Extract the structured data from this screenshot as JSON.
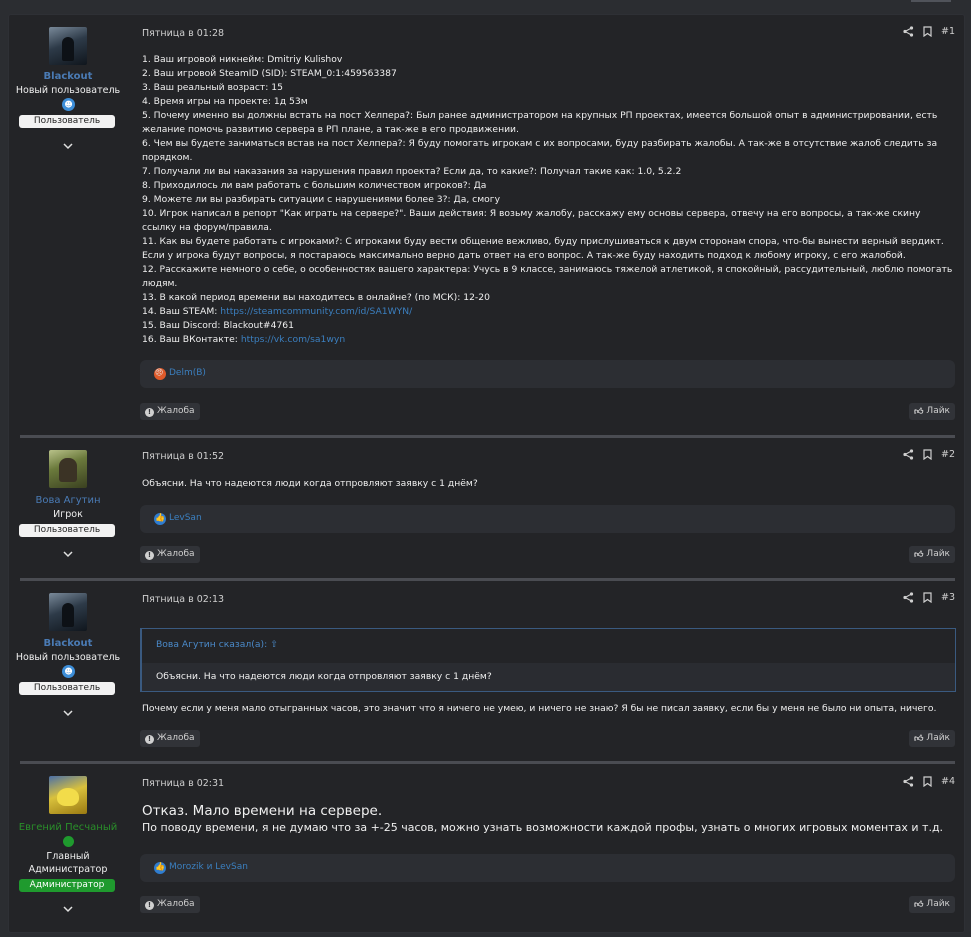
{
  "posts": [
    {
      "user": {
        "name": "Blackout",
        "title": "Новый пользователь",
        "badge": "Пользователь"
      },
      "date": "Пятница в 01:28",
      "number": "#1",
      "lines": [
        "1. Ваш игровой никнейм: Dmitriy Kulishov",
        "2. Ваш игровой SteamID (SID): STEAM_0:1:459563387",
        "3. Ваш реальный возраст: 15",
        "4. Время игры на проекте: 1д 53м",
        "5. Почему именно вы должны встать на пост Хелпера?: Был ранее администратором на крупных РП проектах, имеется большой опыт в администрировании, есть желание помочь развитию сервера в РП плане, а так-же в его продвижении.",
        "6. Чем вы будете заниматься встав на пост Хелпера?: Я буду помогать игрокам с их вопросами, буду разбирать жалобы. А так-же в отсутствие жалоб следить за порядком.",
        "7. Получали ли вы наказания за нарушения правил проекта? Если да, то какие?: Получал такие как: 1.0, 5.2.2",
        "8. Приходилось ли вам работать с большим количеством игроков?: Да",
        "9. Можете ли вы разбирать ситуации с нарушениями более 3?: Да, смогу",
        "10. Игрок написал в репорт \"Как играть на сервере?\". Ваши действия: Я возьму жалобу, расскажу ему основы сервера, отвечу на его вопросы, а так-же скину ссылку на форум/правила.",
        "11. Как вы будете работать с игроками?: С игроками буду вести общение вежливо, буду прислушиваться к двум сторонам спора, что-бы вынести верный вердикт. Если у игрока будут вопросы, я постараюсь максимально верно дать ответ на его вопрос. А так-же буду находить подход к любому игроку, с его жалобой.",
        "12. Расскажите немного о себе, о особенностях вашего характера: Учусь в 9 классе, занимаюсь тяжелой атлетикой, я спокойный, рассудительный, люблю помогать людям.",
        "13. В какой период времени вы находитесь в онлайне? (по МСК): 12-20"
      ],
      "steam_label": "14. Ваш STEAM: ",
      "steam_link": "https://steamcommunity.com/id/SA1WYN/",
      "discord": "15. Ваш Discord: Blackout#4761",
      "vk_label": "16. Ваш ВКонтакте: ",
      "vk_link": "https://vk.com/sa1wyn",
      "reactions": "Delm(B)",
      "report": "Жалоба",
      "like": "Лайк"
    },
    {
      "user": {
        "name": "Вова Агутин",
        "title": "Игрок",
        "badge": "Пользователь"
      },
      "date": "Пятница в 01:52",
      "number": "#2",
      "text": "Объясни. На что надеются люди когда отпровляют заявку с 1 днём?",
      "reactions": "LevSan",
      "report": "Жалоба",
      "like": "Лайк"
    },
    {
      "user": {
        "name": "Blackout",
        "title": "Новый пользователь",
        "badge": "Пользователь"
      },
      "date": "Пятница в 02:13",
      "number": "#3",
      "quote_author": "Вова Агутин сказал(а):",
      "quote_text": "Объясни. На что надеются люди когда отпровляют заявку с 1 днём?",
      "text": "Почему если у меня мало отыгранных часов, это значит что я ничего не умею, и ничего не знаю? Я бы не писал заявку, если бы у меня не было ни опыта, ничего.",
      "report": "Жалоба",
      "like": "Лайк"
    },
    {
      "user": {
        "name": "Евгений Песчаный",
        "title_line1": "Главный",
        "title_line2": "Администратор",
        "badge": "Администратор"
      },
      "date": "Пятница в 02:31",
      "number": "#4",
      "headline": "Отказ. Мало времени на сервере.",
      "text": "По поводу времени, я не думаю что за +-25 часов, можно узнать возможности каждой профы, узнать о многих игровых моментах и т.д.",
      "reactions": "Morozik и LevSan",
      "report": "Жалоба",
      "like": "Лайк"
    }
  ],
  "colors": {
    "background": "#2b2d31",
    "panel": "#232427",
    "link": "#3b7fbf",
    "username_blue": "#4a7bb5",
    "username_green": "#2a8f2a",
    "admin_badge": "#1f9a2e"
  },
  "icons": [
    "share-icon",
    "bookmark-icon",
    "chevron-down-icon",
    "report-icon",
    "like-icon",
    "arrow-up-circle-icon"
  ]
}
